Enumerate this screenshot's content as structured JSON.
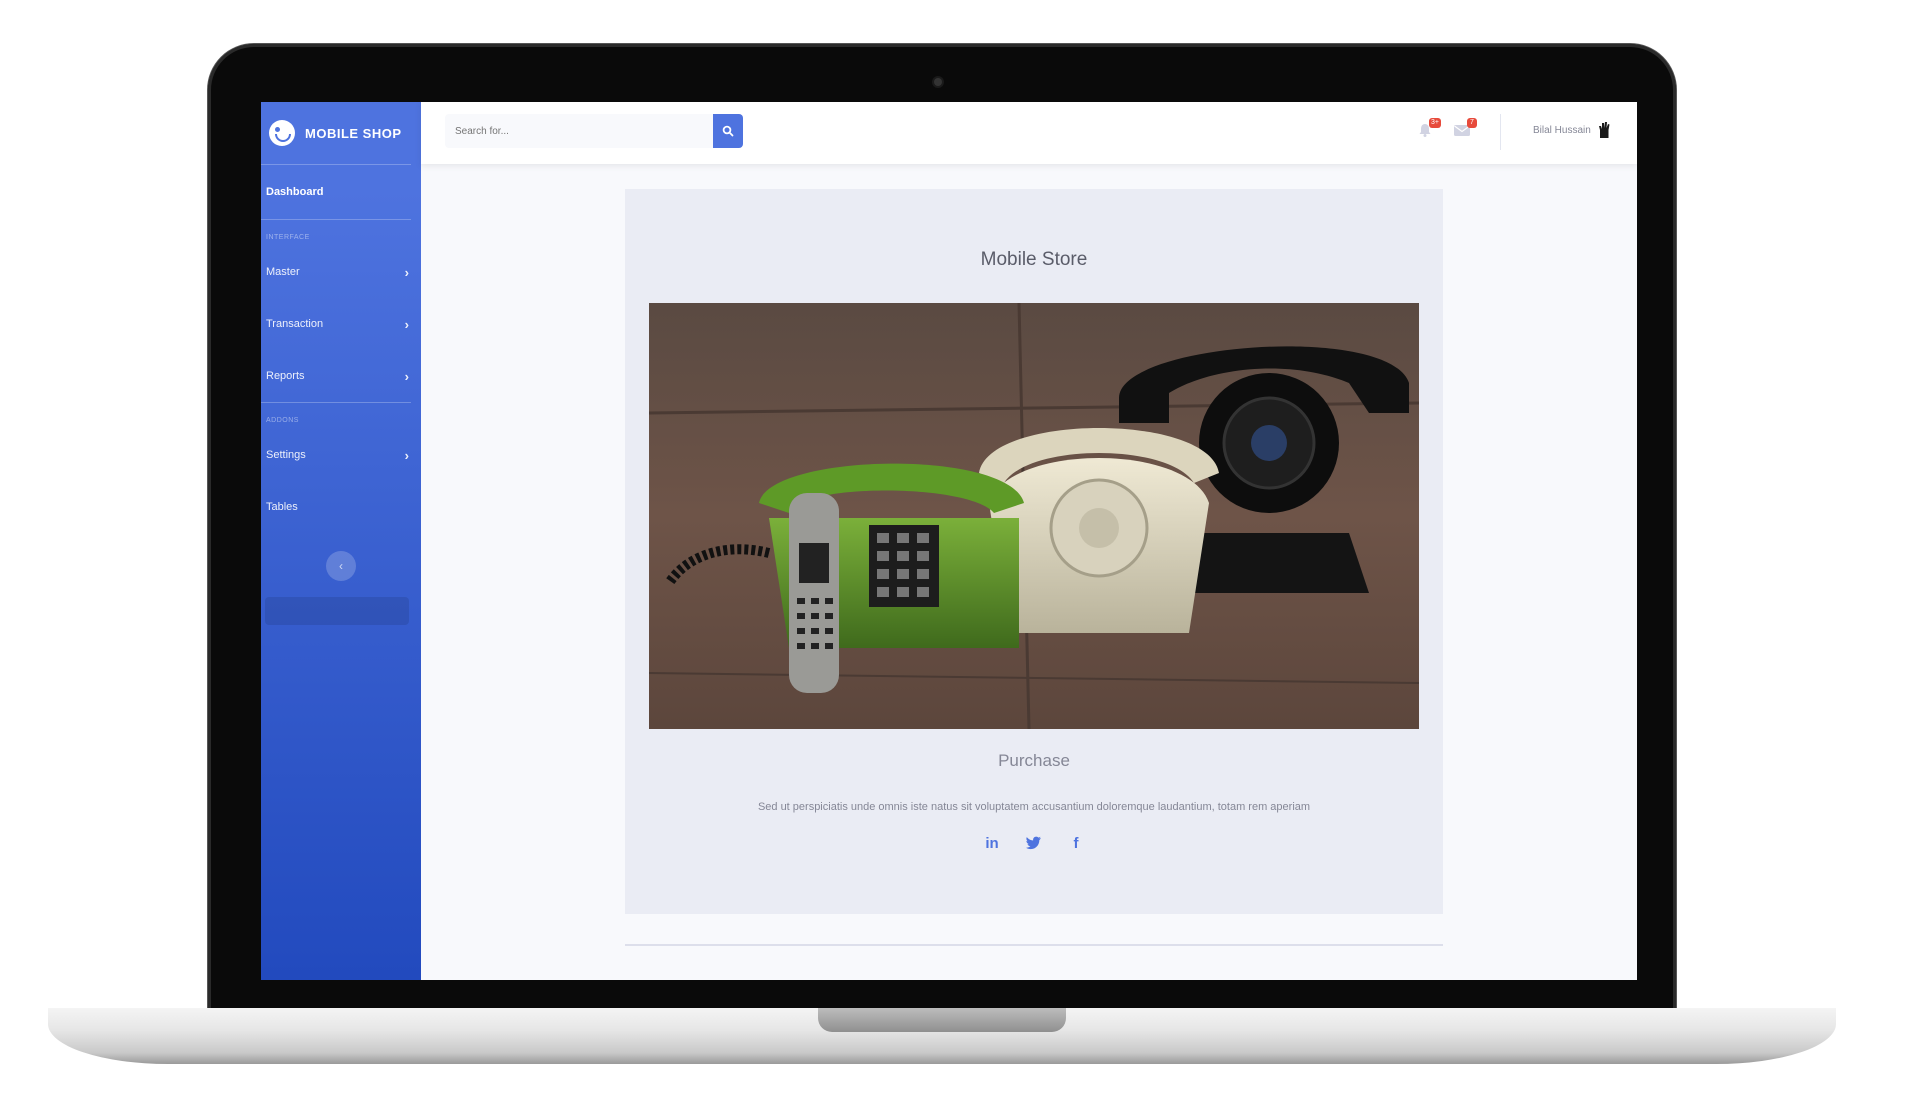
{
  "sidebar": {
    "brand": "MOBILE SHOP",
    "items": [
      {
        "label": "Dashboard"
      },
      {
        "label": "Master"
      },
      {
        "label": "Transaction"
      },
      {
        "label": "Reports"
      },
      {
        "label": "Settings"
      },
      {
        "label": "Tables"
      }
    ],
    "headings": [
      "INTERFACE",
      "ADDONS"
    ],
    "toggle_glyph": "‹"
  },
  "topbar": {
    "search_placeholder": "Search for...",
    "alerts_badge": "3+",
    "messages_badge": "7",
    "user_name": "Bilal Hussain"
  },
  "card": {
    "title": "Mobile Store",
    "subtitle": "Purchase",
    "text": "Sed ut perspiciatis unde omnis iste natus sit voluptatem accusantium doloremque laudantium, totam rem aperiam",
    "socials": [
      {
        "icon": "linkedin-icon",
        "glyph": "in"
      },
      {
        "icon": "twitter-icon",
        "glyph": "🐦"
      },
      {
        "icon": "facebook-icon",
        "glyph": "f"
      }
    ]
  },
  "colors": {
    "primary": "#4e73df",
    "primary_dark": "#224abe",
    "danger": "#e74a3b",
    "card_bg": "#eaecf4"
  }
}
